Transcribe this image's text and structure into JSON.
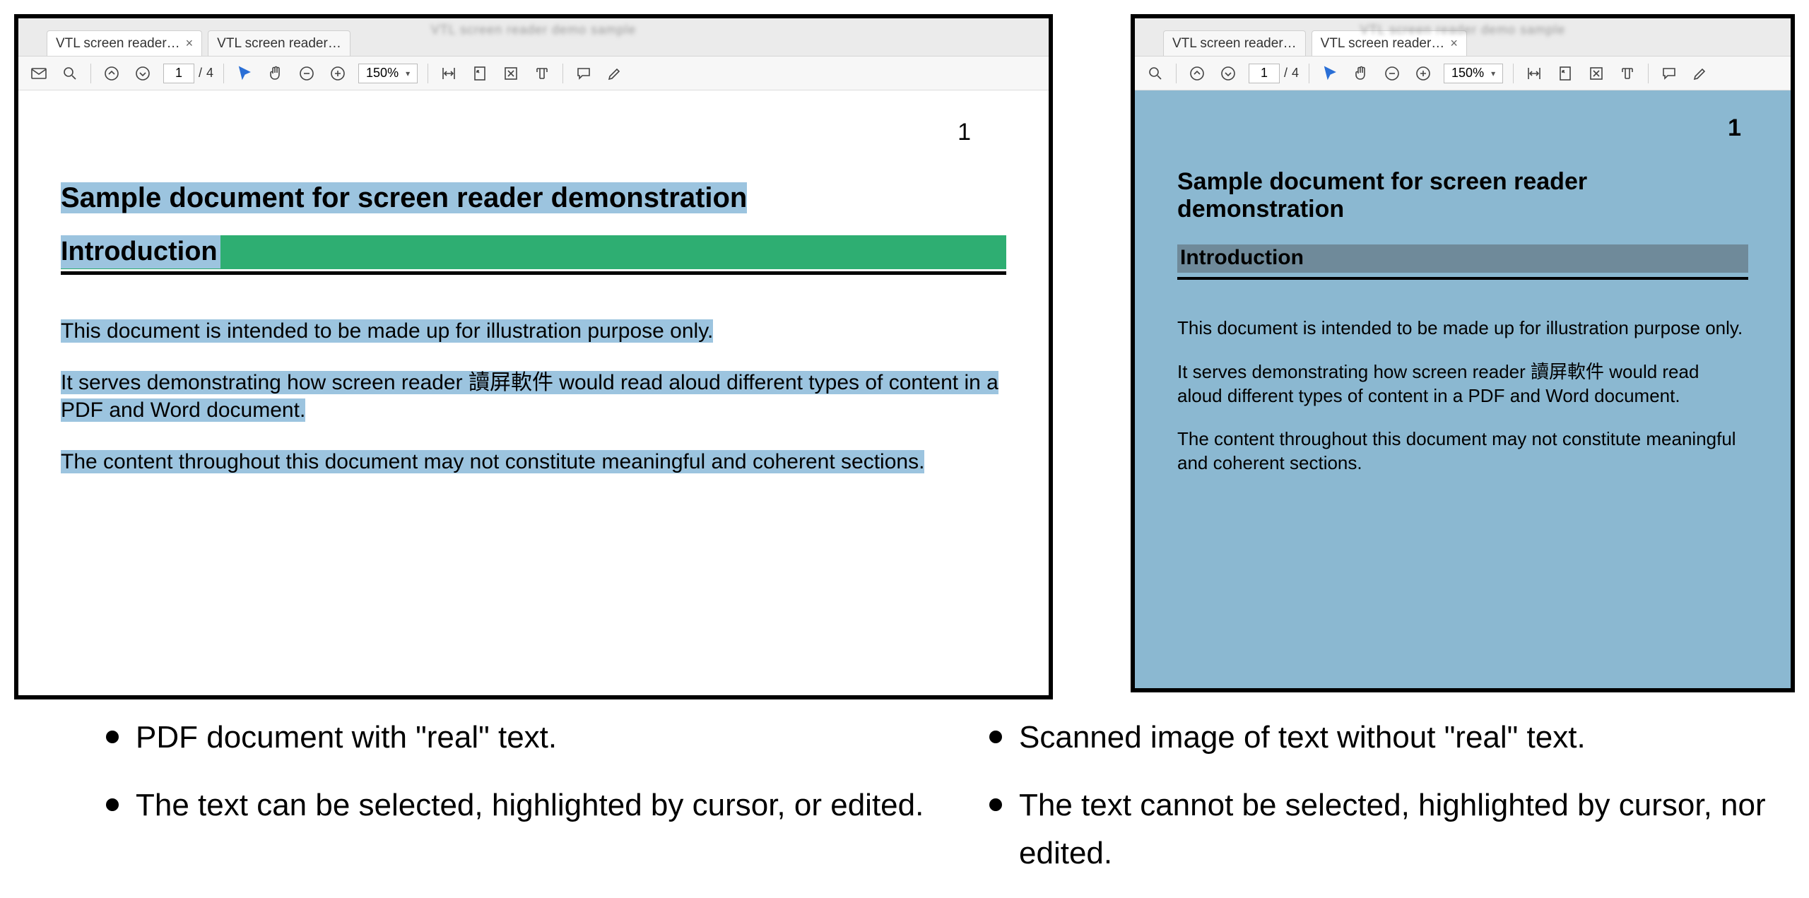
{
  "viewers": {
    "left": {
      "tabs": [
        {
          "label": "VTL screen reader…",
          "closable": true,
          "active": true
        },
        {
          "label": "VTL screen reader…",
          "closable": false,
          "active": false
        }
      ],
      "toolbar": {
        "page_current": "1",
        "page_sep": "/",
        "page_total": "4",
        "zoom": "150%"
      },
      "document": {
        "page_number": "1",
        "title": "Sample document for screen reader demonstration",
        "section_heading": "Introduction",
        "paragraphs": [
          "This document is intended to be made up for illustration purpose only.",
          "It serves demonstrating how screen reader 讀屏軟件 would read aloud different types of content in a PDF and Word document.",
          "The content throughout this document may not constitute meaningful and coherent sections."
        ]
      }
    },
    "right": {
      "tabs": [
        {
          "label": "VTL screen reader…",
          "closable": false,
          "active": false
        },
        {
          "label": "VTL screen reader…",
          "closable": true,
          "active": true
        }
      ],
      "toolbar": {
        "page_current": "1",
        "page_sep": "/",
        "page_total": "4",
        "zoom": "150%"
      },
      "document": {
        "page_number": "1",
        "title": "Sample document for screen reader demonstration",
        "section_heading": "Introduction",
        "paragraphs": [
          "This document is intended to be made up for illustration purpose only.",
          "It serves demonstrating how screen reader 讀屏軟件 would read aloud different types of content in a PDF and Word document.",
          "The content throughout this document may not constitute meaningful and coherent sections."
        ]
      }
    }
  },
  "captions": {
    "left": [
      "PDF document with \"real\" text.",
      "The text can be selected, highlighted by cursor, or edited."
    ],
    "right": [
      "Scanned image of text without \"real\" text.",
      "The text cannot be selected, highlighted by cursor, nor edited."
    ]
  }
}
